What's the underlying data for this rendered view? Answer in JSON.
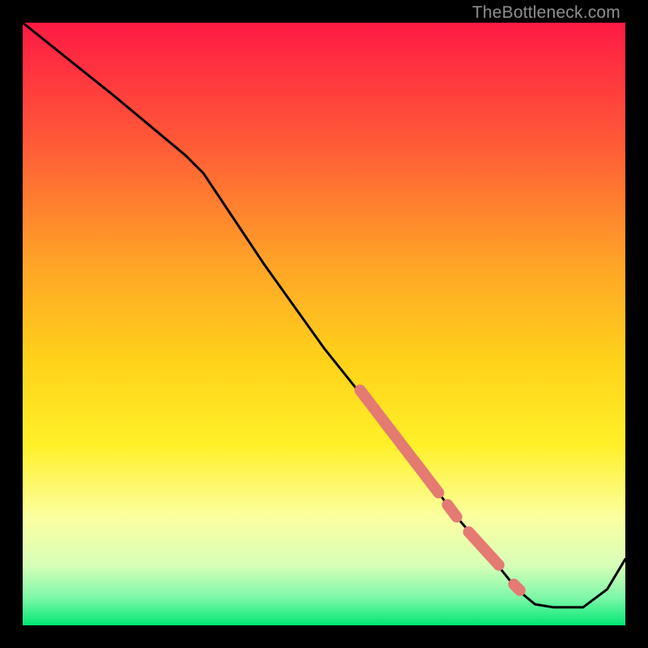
{
  "watermark": "TheBottleneck.com",
  "chart_data": {
    "type": "line",
    "title": "",
    "xlabel": "",
    "ylabel": "",
    "xlim": [
      0,
      100
    ],
    "ylim": [
      0,
      100
    ],
    "grid": false,
    "legend": false,
    "background_gradient": {
      "note": "vertical gradient from red (top) through orange, yellow, pale yellow, to bright green (bottom)",
      "stops": [
        {
          "pos": 0.0,
          "color": "#ff1a44"
        },
        {
          "pos": 0.2,
          "color": "#ff5a37"
        },
        {
          "pos": 0.4,
          "color": "#ffa427"
        },
        {
          "pos": 0.56,
          "color": "#ffd21a"
        },
        {
          "pos": 0.7,
          "color": "#fff028"
        },
        {
          "pos": 0.82,
          "color": "#fcffa0"
        },
        {
          "pos": 0.9,
          "color": "#d8ffb8"
        },
        {
          "pos": 0.955,
          "color": "#7cf7a8"
        },
        {
          "pos": 1.0,
          "color": "#00e874"
        }
      ]
    },
    "series": [
      {
        "name": "curve",
        "note": "main black curve; y in percent of plot height from top (0=top, 100=bottom)",
        "color": "#000000",
        "x": [
          0,
          5,
          15,
          27,
          30,
          40,
          50,
          58,
          66,
          72,
          78,
          82,
          85,
          88,
          93,
          97,
          100
        ],
        "y": [
          0,
          4,
          12,
          22,
          25,
          40,
          54,
          64,
          74,
          82,
          89,
          94,
          96.5,
          97,
          97,
          94,
          89
        ]
      }
    ],
    "highlight_segments": {
      "note": "thick salmon overlay beads on the descending part of the curve",
      "color": "#e47a72",
      "segments": [
        {
          "x0": 56,
          "y0": 61,
          "x1": 69,
          "y1": 78
        },
        {
          "x0": 70.5,
          "y0": 80,
          "x1": 72,
          "y1": 82
        },
        {
          "x0": 74,
          "y0": 84.5,
          "x1": 79,
          "y1": 90
        },
        {
          "x0": 81.5,
          "y0": 93.2,
          "x1": 82.5,
          "y1": 94.2
        }
      ]
    }
  }
}
